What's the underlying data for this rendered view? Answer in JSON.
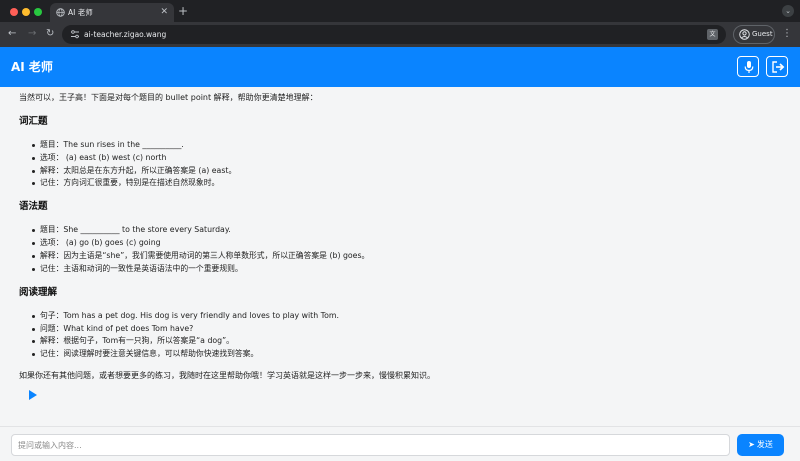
{
  "browser": {
    "tab_title": "AI 老师",
    "url": "ai-teacher.zigao.wang",
    "profile_label": "Guest"
  },
  "app": {
    "title": "AI 老师"
  },
  "message": {
    "intro": "当然可以，王子高！下面是对每个题目的 bullet point 解释，帮助你更清楚地理解：",
    "sections": [
      {
        "heading": "词汇题",
        "items": [
          "题目：The sun rises in the __________.",
          "选项： (a) east (b) west (c) north",
          "解释：太阳总是在东方升起，所以正确答案是 (a) east。",
          "记住：方向词汇很重要，特别是在描述自然现象时。"
        ]
      },
      {
        "heading": "语法题",
        "items": [
          "题目：She __________ to the store every Saturday.",
          "选项： (a) go (b) goes (c) going",
          "解释：因为主语是“she”，我们需要使用动词的第三人称单数形式，所以正确答案是 (b) goes。",
          "记住：主语和动词的一致性是英语语法中的一个重要规则。"
        ]
      },
      {
        "heading": "阅读理解",
        "items": [
          "句子：Tom has a pet dog. His dog is very friendly and loves to play with Tom.",
          "问题：What kind of pet does Tom have?",
          "解释：根据句子，Tom有一只狗，所以答案是“a dog”。",
          "记住：阅读理解时要注意关键信息，可以帮助你快速找到答案。"
        ]
      }
    ],
    "outro": "如果你还有其他问题，或者想要更多的练习，我随时在这里帮助你哦！学习英语就是这样一步一步来，慢慢积累知识。"
  },
  "composer": {
    "placeholder": "提问或输入内容...",
    "send_label": "发送"
  },
  "colors": {
    "accent": "#0a84ff",
    "content_bg": "#f4f5f6"
  }
}
